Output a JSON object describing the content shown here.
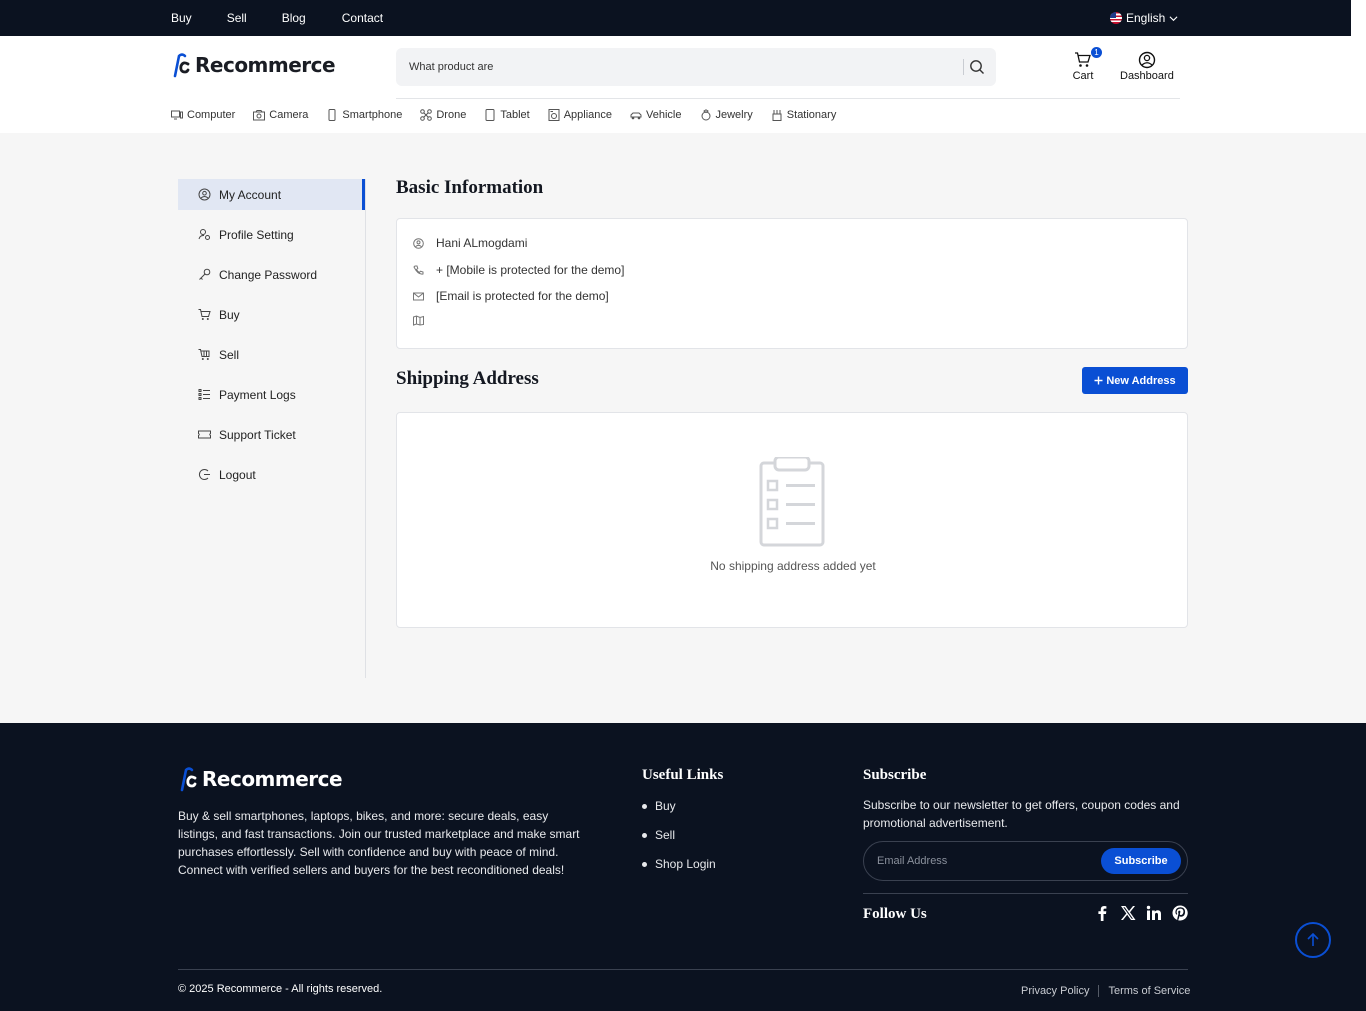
{
  "topbar": {
    "links": [
      "Buy",
      "Sell",
      "Blog",
      "Contact"
    ],
    "language": "English"
  },
  "header": {
    "logo_text": "Recommerce",
    "search_placeholder": "What product are",
    "cart_label": "Cart",
    "cart_count": "1",
    "dashboard_label": "Dashboard"
  },
  "categories": [
    "Computer",
    "Camera",
    "Smartphone",
    "Drone",
    "Tablet",
    "Appliance",
    "Vehicle",
    "Jewelry",
    "Stationary"
  ],
  "sidebar": {
    "items": [
      "My Account",
      "Profile Setting",
      "Change Password",
      "Buy",
      "Sell",
      "Payment Logs",
      "Support Ticket",
      "Logout"
    ],
    "active": "My Account"
  },
  "basic_info": {
    "title": "Basic Information",
    "name": "Hani ALmogdami",
    "phone": "+ [Mobile is protected for the demo]",
    "email": "[Email is protected for the demo]",
    "address": ""
  },
  "shipping": {
    "title": "Shipping Address",
    "new_button": "New Address",
    "empty_text": "No shipping address added yet"
  },
  "footer": {
    "logo_text": "Recommerce",
    "description": "Buy & sell smartphones, laptops, bikes, and more: secure deals, easy listings, and fast transactions. Join our trusted marketplace and make smart purchases effortlessly. Sell with confidence and buy with peace of mind. Connect with verified sellers and buyers for the best reconditioned deals!",
    "useful_links_title": "Useful Links",
    "useful_links": [
      "Buy",
      "Sell",
      "Shop Login"
    ],
    "subscribe_title": "Subscribe",
    "subscribe_text": "Subscribe to our newsletter to get offers, coupon codes and promotional advertisement.",
    "email_placeholder": "Email Address",
    "subscribe_button": "Subscribe",
    "follow_title": "Follow Us",
    "social": [
      "facebook-icon",
      "x-icon",
      "linkedin-icon",
      "pinterest-icon"
    ],
    "copyright": "© 2025 Recommerce - All rights reserved.",
    "privacy": "Privacy Policy",
    "terms": "Terms of Service"
  },
  "colors": {
    "accent": "#0a4fd4",
    "dark": "#0b1220"
  }
}
